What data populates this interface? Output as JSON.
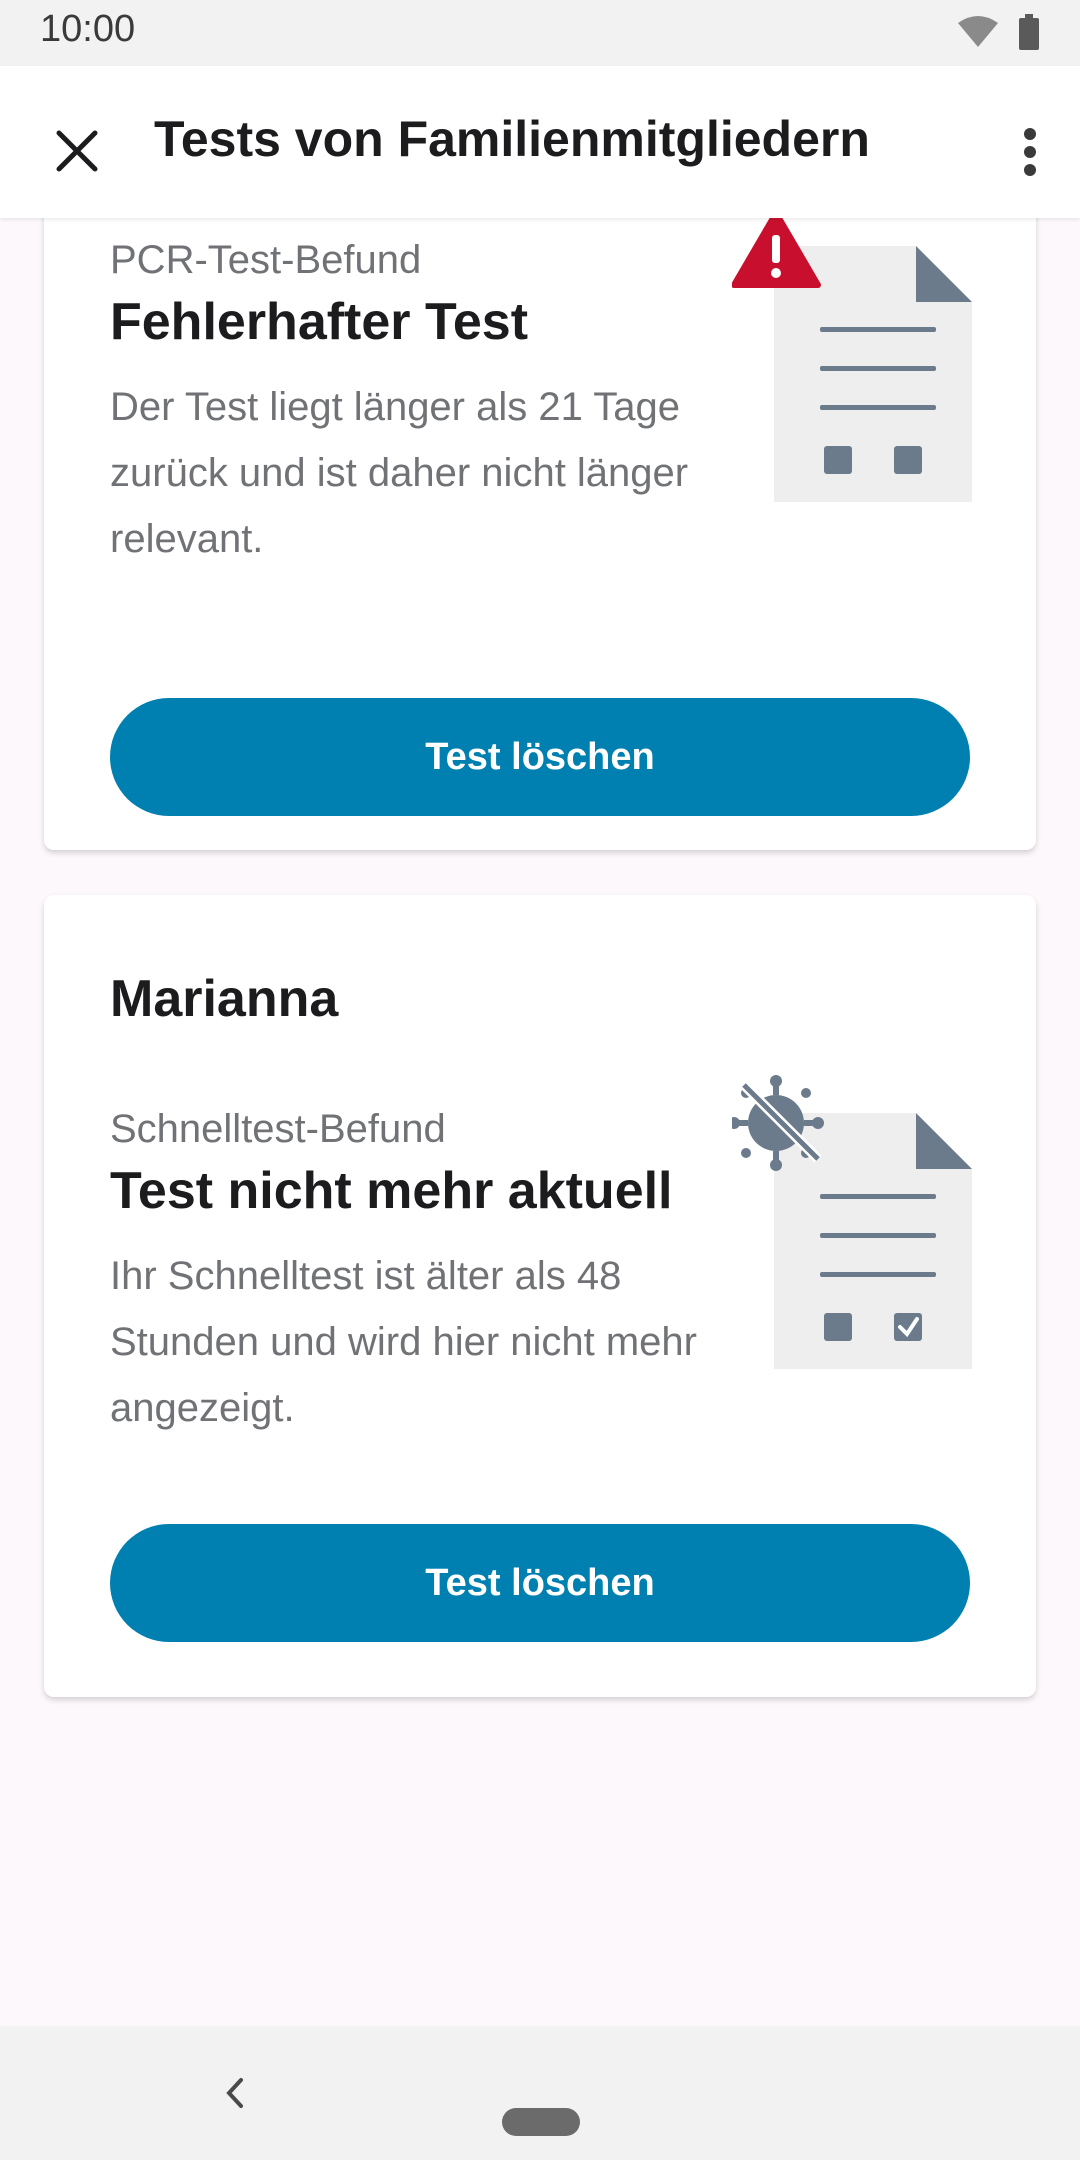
{
  "status_bar": {
    "time": "10:00"
  },
  "app_bar": {
    "title": "Tests von Familienmitgliedern"
  },
  "cards": [
    {
      "subtitle": "PCR-Test-Befund",
      "heading": "Fehlerhafter Test",
      "body": "Der Test liegt länger als 21 Tage zurück und ist daher nicht länger relevant.",
      "button": "Test löschen"
    },
    {
      "person": "Marianna",
      "subtitle": "Schnelltest-Befund",
      "heading": "Test nicht mehr aktuell",
      "body": "Ihr Schnelltest ist älter als 48 Stunden und wird hier nicht mehr angezeigt.",
      "button": "Test löschen"
    }
  ],
  "colors": {
    "primary": "#0080b0",
    "warning": "#c8102e",
    "illustration": "#6b7b8c"
  }
}
